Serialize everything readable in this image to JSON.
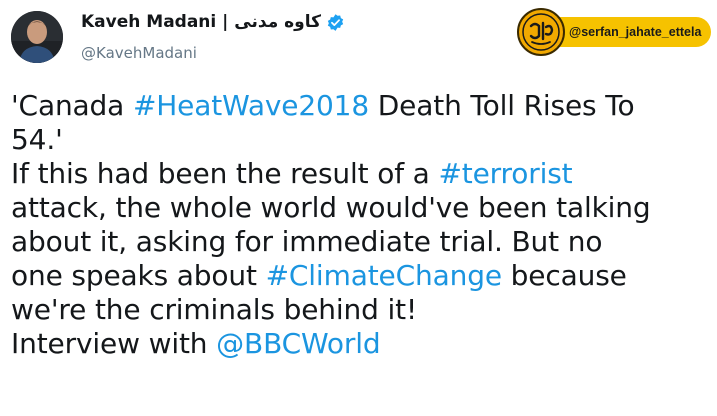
{
  "author": {
    "name": "Kaveh Madani | کاوه مدنی",
    "handle": "@KavehMadani",
    "verified": true,
    "avatar": "avatar"
  },
  "watermark": {
    "text": "@serfan_jahate_ettela",
    "logo_text": "اطلاع رسانی",
    "colors": {
      "background": "#f6c200",
      "logo": "#f2a900"
    }
  },
  "tweet": {
    "lines": [
      [
        {
          "text": "'Canada "
        },
        {
          "text": "#HeatWave2018",
          "link": true
        },
        {
          "text": " Death Toll Rises To"
        }
      ],
      [
        {
          "text": "54.'"
        }
      ],
      [
        {
          "text": "If this had been the result of a "
        },
        {
          "text": "#terrorist",
          "link": true
        }
      ],
      [
        {
          "text": "attack, the whole world would've been talking"
        }
      ],
      [
        {
          "text": "about it, asking for immediate trial. But no"
        }
      ],
      [
        {
          "text": "one speaks about "
        },
        {
          "text": "#ClimateChange",
          "link": true
        },
        {
          "text": " because"
        }
      ],
      [
        {
          "text": "we're the criminals behind it!"
        }
      ],
      [
        {
          "text": "Interview with "
        },
        {
          "text": "@BBCWorld",
          "link": true
        }
      ]
    ]
  },
  "colors": {
    "link": "#1b95e0",
    "text": "#14171a",
    "secondary": "#657786"
  }
}
